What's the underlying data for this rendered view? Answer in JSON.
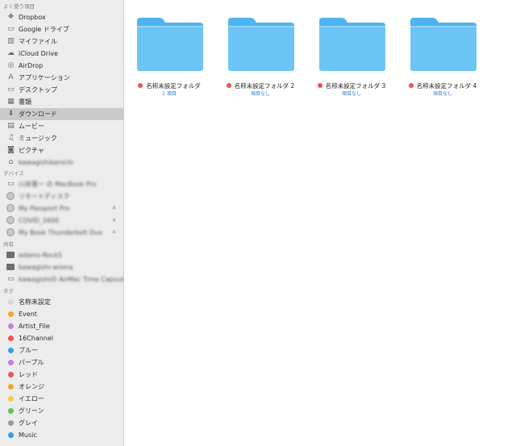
{
  "sidebar": {
    "favorites_header": "よく使う項目",
    "favorites": [
      {
        "label": "Dropbox",
        "icon": "dropbox-icon"
      },
      {
        "label": "Google ドライブ",
        "icon": "folder-icon"
      },
      {
        "label": "マイファイル",
        "icon": "all-files-icon"
      },
      {
        "label": "iCloud Drive",
        "icon": "cloud-icon"
      },
      {
        "label": "AirDrop",
        "icon": "airdrop-icon"
      },
      {
        "label": "アプリケーション",
        "icon": "applications-icon"
      },
      {
        "label": "デスクトップ",
        "icon": "desktop-icon"
      },
      {
        "label": "書類",
        "icon": "documents-icon"
      },
      {
        "label": "ダウンロード",
        "icon": "download-icon",
        "selected": true
      },
      {
        "label": "ムービー",
        "icon": "movies-icon"
      },
      {
        "label": "ミュージック",
        "icon": "music-icon"
      },
      {
        "label": "ピクチャ",
        "icon": "camera-icon"
      },
      {
        "label": "kawagishikenichi",
        "icon": "home-icon"
      }
    ],
    "devices_header": "デバイス",
    "devices": [
      {
        "label": "川岸憲一 の MacBook Pro",
        "icon": "laptop-icon"
      },
      {
        "label": "リモートディスク",
        "icon": "disc-icon"
      },
      {
        "label": "My Passport Pro",
        "icon": "drive-icon",
        "eject": "≙"
      },
      {
        "label": "COVID_1600",
        "icon": "drive-icon",
        "eject": "≙"
      },
      {
        "label": "My Book Thunderbolt Duo",
        "icon": "drive-icon",
        "eject": "≙"
      }
    ],
    "shared_header": "共有",
    "shared": [
      {
        "label": "adams-RockS",
        "icon": "computer-icon"
      },
      {
        "label": "kawagishi-anima",
        "icon": "computer-icon"
      },
      {
        "label": "kawagishiの AirMac Time Capsule",
        "icon": "time-capsule-icon"
      }
    ],
    "tags_header": "タグ",
    "tags": [
      {
        "label": "名称未設定",
        "color": "#d9d9d9"
      },
      {
        "label": "Event",
        "color": "#f5a623"
      },
      {
        "label": "Artist_File",
        "color": "#c77de0"
      },
      {
        "label": "16Channel",
        "color": "#ef5350"
      },
      {
        "label": "ブルー",
        "color": "#2f9bef"
      },
      {
        "label": "パープル",
        "color": "#c77de0"
      },
      {
        "label": "レッド",
        "color": "#ef5350"
      },
      {
        "label": "オレンジ",
        "color": "#f5a623"
      },
      {
        "label": "イエロー",
        "color": "#f7ce3e"
      },
      {
        "label": "グリーン",
        "color": "#5cc15a"
      },
      {
        "label": "グレイ",
        "color": "#9b9b9b"
      },
      {
        "label": "Music",
        "color": "#2f9bef"
      }
    ]
  },
  "folders": [
    {
      "name": "名称未設定フォルダ",
      "sub": "2 項目",
      "tag_color": "#f0504a"
    },
    {
      "name": "名称未設定フォルダ 2",
      "sub": "項目なし",
      "tag_color": "#f0504a"
    },
    {
      "name": "名称未設定フォルダ 3",
      "sub": "項目なし",
      "tag_color": "#f0504a"
    },
    {
      "name": "名称未設定フォルダ 4",
      "sub": "項目なし",
      "tag_color": "#f0504a"
    }
  ],
  "colors": {
    "sidebar_bg": "#ececec",
    "selected_row": "#cacaca",
    "folder_blue": "#6cc4f7",
    "link_blue": "#2f7bd8"
  }
}
